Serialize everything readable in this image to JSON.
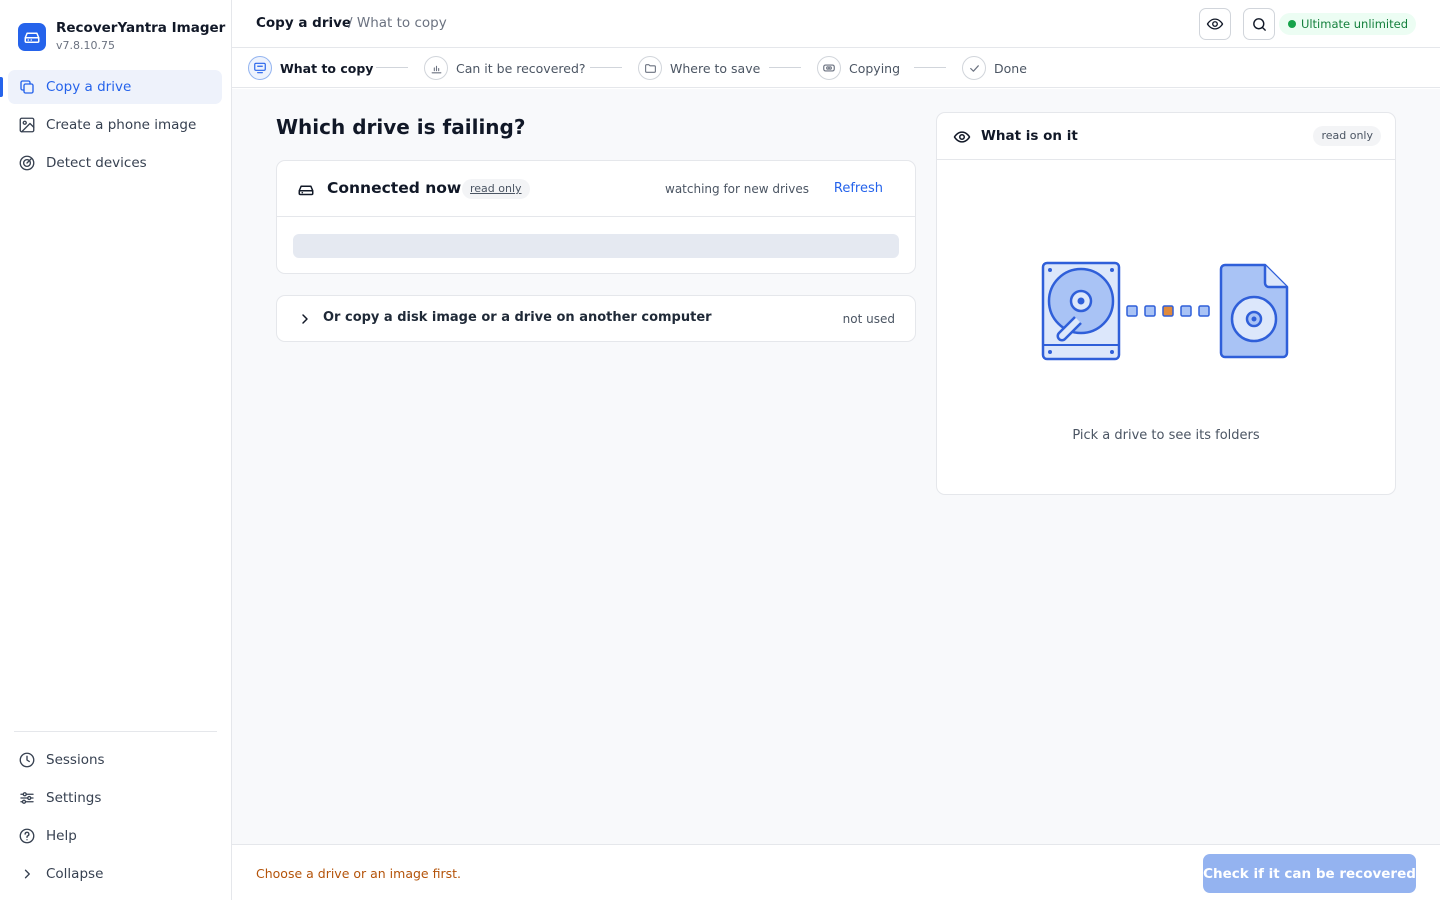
{
  "app": {
    "name": "RecoverYantra Imager",
    "version": "v7.8.10.75"
  },
  "sidebar": {
    "items": [
      {
        "label": "Copy a drive",
        "icon": "copy-icon",
        "active": true
      },
      {
        "label": "Create a phone image",
        "icon": "image-icon",
        "active": false
      },
      {
        "label": "Detect devices",
        "icon": "radar-icon",
        "active": false
      }
    ],
    "bottom_items": [
      {
        "label": "Sessions",
        "icon": "clock-icon"
      },
      {
        "label": "Settings",
        "icon": "sliders-icon"
      },
      {
        "label": "Help",
        "icon": "help-icon"
      },
      {
        "label": "Collapse",
        "icon": "chevron-right-icon"
      }
    ]
  },
  "header": {
    "breadcrumb_main": "Copy a drive",
    "breadcrumb_sub": "/ What to copy",
    "plan_badge": "Ultimate  unlimited"
  },
  "stepper": {
    "steps": [
      {
        "label": "What to copy",
        "active": true
      },
      {
        "label": "Can it be recovered?",
        "active": false
      },
      {
        "label": "Where to save",
        "active": false
      },
      {
        "label": "Copying",
        "active": false
      },
      {
        "label": "Done",
        "active": false
      }
    ]
  },
  "main": {
    "title": "Which drive is failing?",
    "connected": {
      "title": "Connected now",
      "tag": "read only",
      "watching": "watching for new drives",
      "refresh": "Refresh"
    },
    "other_source": {
      "label": "Or copy a disk image or a drive on another computer",
      "status": "not used"
    },
    "preview": {
      "title": "What is on it",
      "tag": "read only",
      "caption": "Pick a drive to see its folders"
    }
  },
  "footer": {
    "message": "Choose a drive or an image first.",
    "primary_button": "Check if it can be recovered"
  },
  "colors": {
    "accent": "#2563eb",
    "warning_text": "#b45309",
    "success": "#16a34a",
    "disabled_button": "#94b3f0"
  }
}
